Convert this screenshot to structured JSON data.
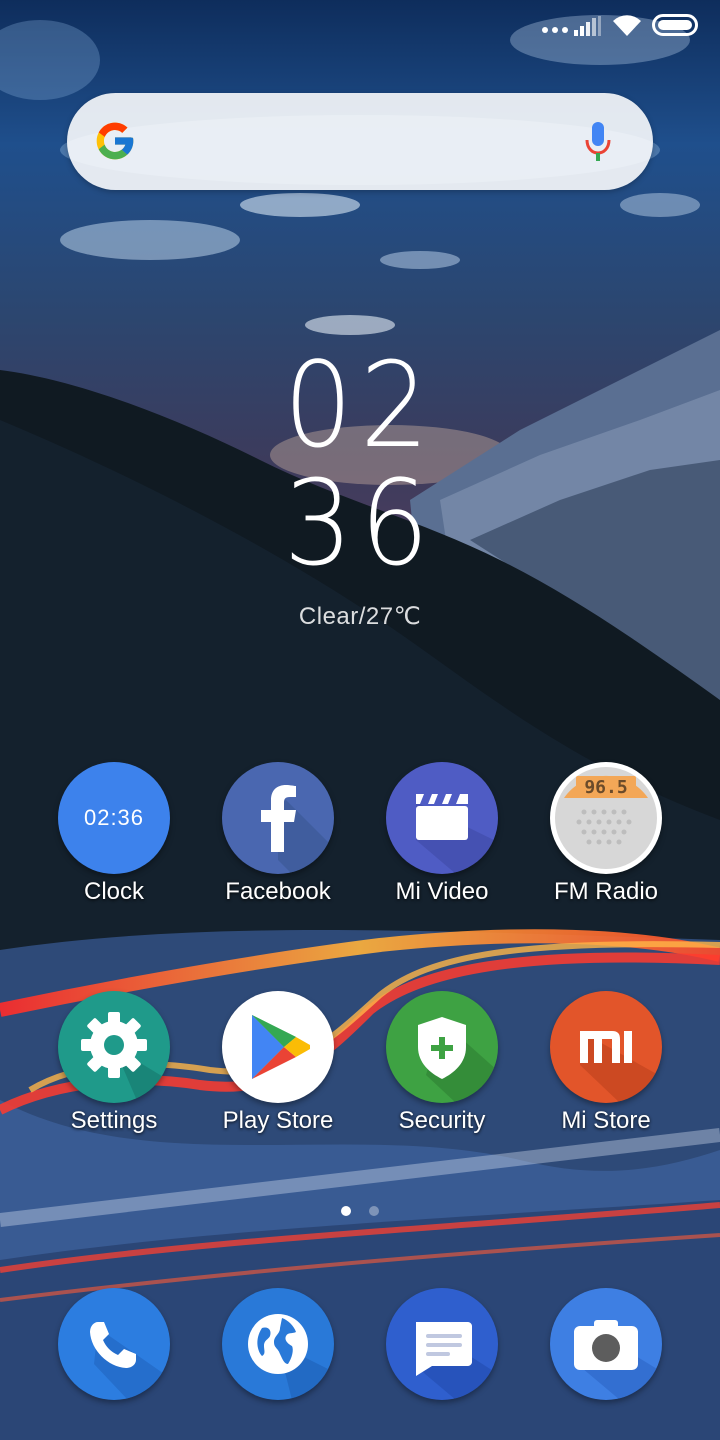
{
  "status_bar": {
    "icons": [
      "more-dots-icon",
      "signal-icon",
      "wifi-icon",
      "battery-icon"
    ]
  },
  "search": {
    "logo": "google-logo",
    "voice": "mic-icon"
  },
  "clock_widget": {
    "hours": "02",
    "minutes": "36",
    "weather": "Clear/27℃"
  },
  "apps": [
    {
      "label": "Clock",
      "icon": "clock-icon",
      "icon_text": "02:36",
      "color": "#3d82ec"
    },
    {
      "label": "Facebook",
      "icon": "facebook-icon",
      "color": "#4a67b0"
    },
    {
      "label": "Mi Video",
      "icon": "clapperboard-icon",
      "color": "#4f5cc4"
    },
    {
      "label": "FM Radio",
      "icon": "radio-icon",
      "icon_text": "96.5",
      "color": "#ffffff"
    },
    {
      "label": "Settings",
      "icon": "gear-icon",
      "color": "#1f9a8a"
    },
    {
      "label": "Play Store",
      "icon": "play-store-icon",
      "color": "#ffffff"
    },
    {
      "label": "Security",
      "icon": "shield-plus-icon",
      "color": "#3ea243"
    },
    {
      "label": "Mi Store",
      "icon": "mi-logo-icon",
      "color": "#e2552a"
    }
  ],
  "page_indicator": {
    "pages": 2,
    "current": 1
  },
  "dock": [
    {
      "icon": "phone-icon",
      "color": "#2c7de0"
    },
    {
      "icon": "globe-icon",
      "color": "#2979d8"
    },
    {
      "icon": "message-icon",
      "color": "#2f5fce"
    },
    {
      "icon": "camera-icon",
      "color": "#3e7fe3"
    }
  ]
}
